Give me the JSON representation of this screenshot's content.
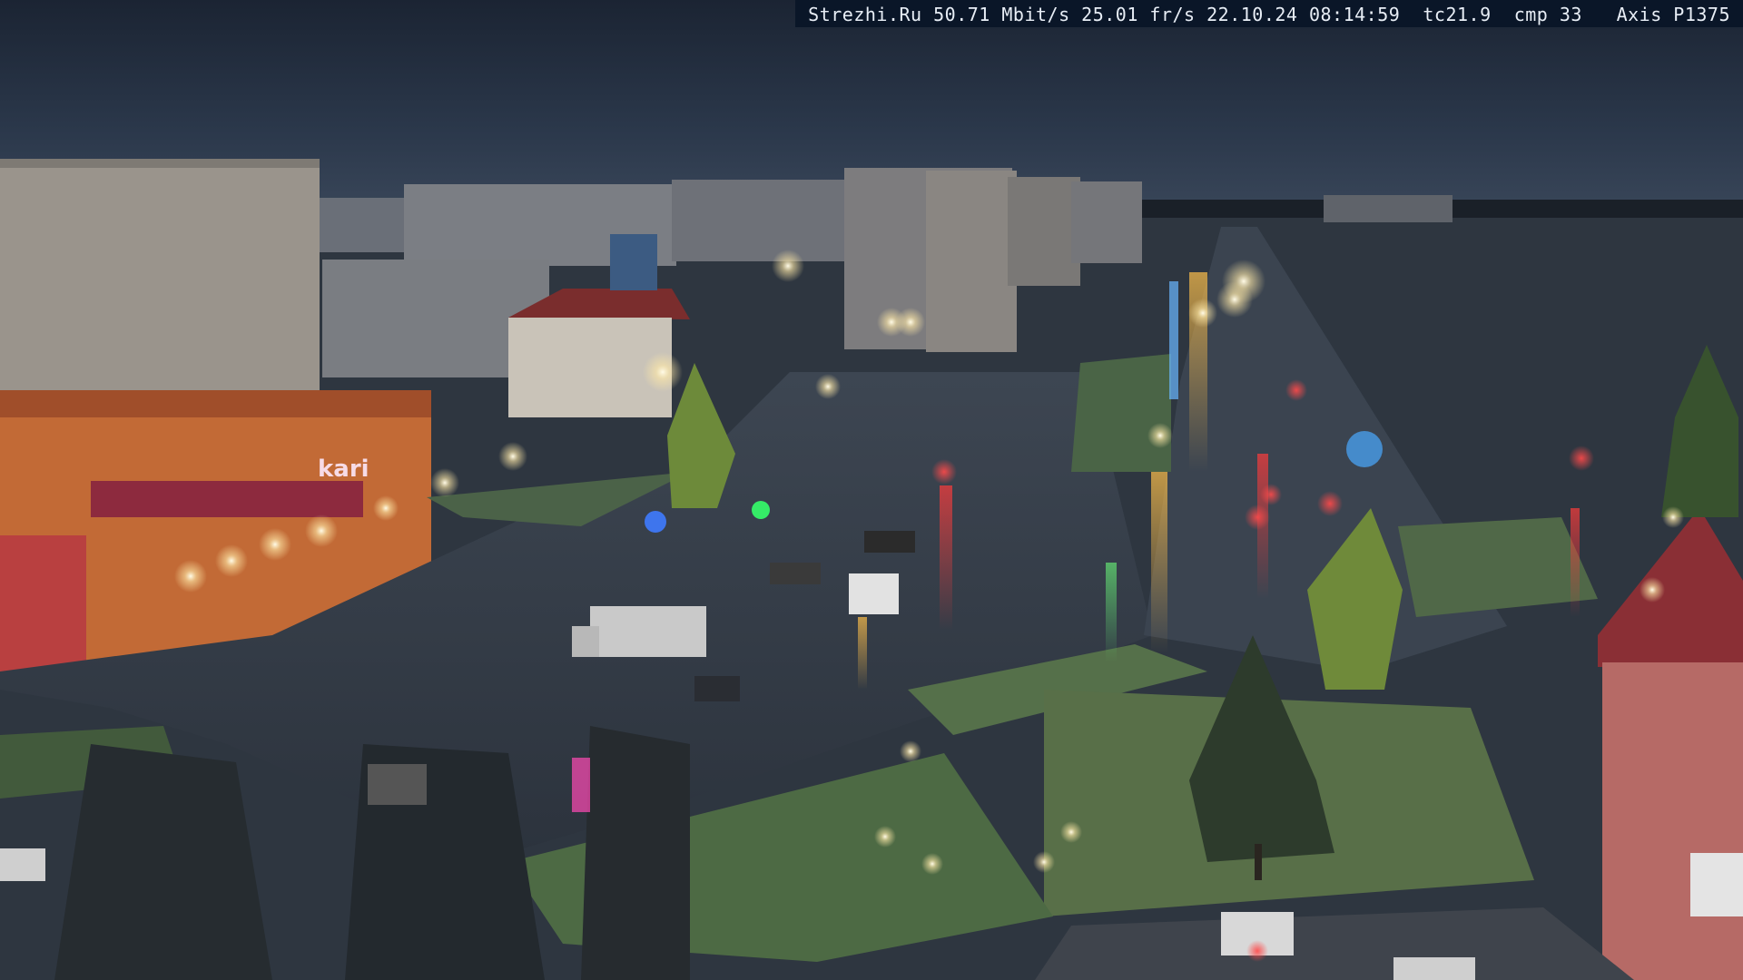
{
  "camera_overlay": {
    "text": "Strezhi.Ru 50.71 Mbit/s 25.01 fr/s 22.10.24 08:14:59  tc21.9  cmp 33   Axis P1375"
  },
  "colors": {
    "sky": "#253244",
    "road": "#3a4350",
    "grass": "#55704a",
    "lamp": "#f6f1d8",
    "overlay_bg": "#0a1628",
    "overlay_text": "#e8eef6"
  },
  "signage": {
    "store_brand": "kari"
  }
}
